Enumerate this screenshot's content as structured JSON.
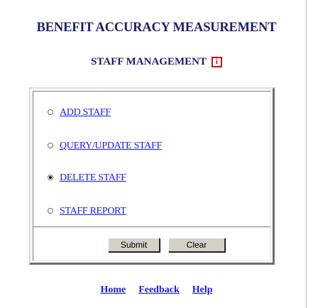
{
  "header": {
    "title": "BENEFIT ACCURACY MEASUREMENT",
    "subtitle": "STAFF MANAGEMENT",
    "info_icon": {
      "glyph": "i",
      "name": "info-icon",
      "color": "#c01818"
    }
  },
  "form": {
    "options": [
      {
        "label": "ADD STAFF",
        "selected": false
      },
      {
        "label": "QUERY/UPDATE STAFF",
        "selected": false
      },
      {
        "label": "DELETE STAFF",
        "selected": true
      },
      {
        "label": "STAFF REPORT",
        "selected": false
      }
    ],
    "buttons": {
      "submit": "Submit",
      "clear": "Clear"
    }
  },
  "footer": {
    "links": [
      "Home",
      "Feedback",
      "Help"
    ]
  },
  "colors": {
    "heading": "#20206a",
    "link": "#1a1aee",
    "button_face": "#d4d0c8"
  }
}
